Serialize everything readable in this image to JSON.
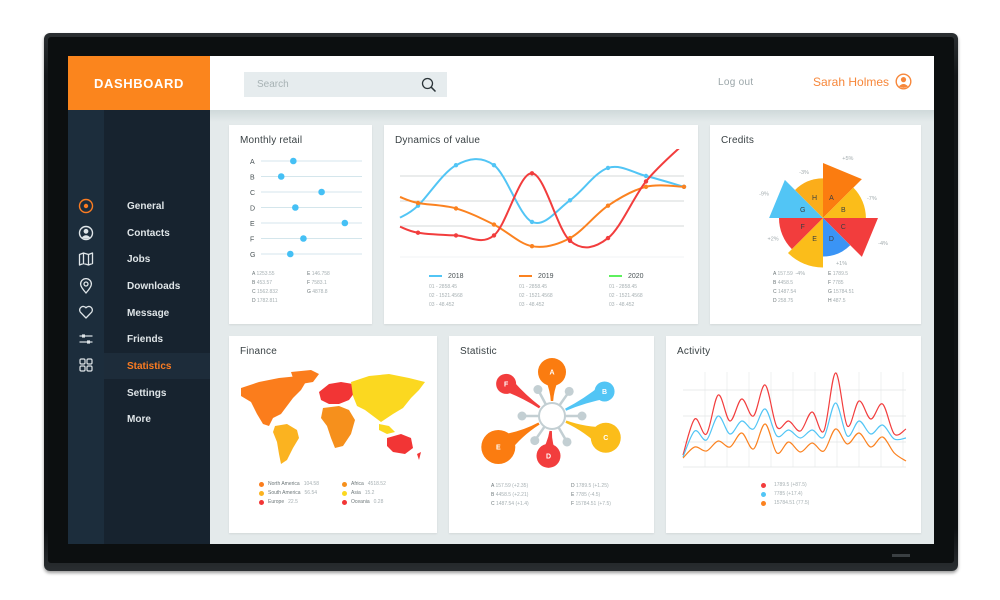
{
  "header": {
    "app_title": "DASHBOARD",
    "search_placeholder": "Search",
    "logout_label": "Log out",
    "user_name": "Sarah Holmes",
    "accent_color": "#fb851d"
  },
  "sidebar": {
    "icons": [
      "target-icon",
      "user-circle-icon",
      "map-icon",
      "location-pin-icon",
      "heart-icon",
      "sliders-icon",
      "grid-icon"
    ],
    "items": [
      {
        "label": "General"
      },
      {
        "label": "Contacts"
      },
      {
        "label": "Jobs"
      },
      {
        "label": "Downloads"
      },
      {
        "label": "Message"
      },
      {
        "label": "Friends"
      },
      {
        "label": "Statistics",
        "active": true
      },
      {
        "label": "Settings"
      },
      {
        "label": "More"
      }
    ]
  },
  "cards": {
    "monthly_retail": {
      "title": "Monthly retail",
      "rows": [
        {
          "label": "A",
          "value": 0.32
        },
        {
          "label": "B",
          "value": 0.2
        },
        {
          "label": "C",
          "value": 0.6
        },
        {
          "label": "D",
          "value": 0.34
        },
        {
          "label": "E",
          "value": 0.83
        },
        {
          "label": "F",
          "value": 0.42
        },
        {
          "label": "G",
          "value": 0.29
        }
      ],
      "stats": [
        {
          "k": "A",
          "v": "1253.55"
        },
        {
          "k": "E",
          "v": "146.758"
        },
        {
          "k": "B",
          "v": "453.57"
        },
        {
          "k": "F",
          "v": "7583.1"
        },
        {
          "k": "C",
          "v": "1562.832"
        },
        {
          "k": "G",
          "v": "4878.8"
        },
        {
          "k": "D",
          "v": "1782.811"
        }
      ]
    },
    "dynamics": {
      "title": "Dynamics of value",
      "legend": [
        {
          "label": "2018",
          "color": "#52c5f5",
          "lines": [
            "01 - 2858.45",
            "02 - 1521.4568",
            "03 - 48.452"
          ]
        },
        {
          "label": "2019",
          "color": "#fb8220",
          "lines": [
            "01 - 2858.45",
            "02 - 1521.4568",
            "03 - 48.452"
          ]
        },
        {
          "label": "2020",
          "color": "#5ef05e",
          "lines": [
            "01 - 2858.45",
            "02 - 1521.4568",
            "03 - 48.452"
          ]
        }
      ]
    },
    "credits": {
      "title": "Credits",
      "stats": [
        {
          "k": "A",
          "v": "157.59"
        },
        {
          "k": "E",
          "v": "1789.5"
        },
        {
          "k": "B",
          "v": "4458.5"
        },
        {
          "k": "F",
          "v": "7785"
        },
        {
          "k": "C",
          "v": "1487.54"
        },
        {
          "k": "G",
          "v": "15784.51"
        },
        {
          "k": "D",
          "v": "258.75"
        },
        {
          "k": "H",
          "v": "487.5"
        }
      ]
    },
    "finance": {
      "title": "Finance",
      "legend": [
        {
          "label": "North America",
          "value": "104.58",
          "color": "#fb7d1c"
        },
        {
          "label": "Africa",
          "value": "4518.52",
          "color": "#f6901c"
        },
        {
          "label": "South America",
          "value": "56.54",
          "color": "#fbb320"
        },
        {
          "label": "Asia",
          "value": "15.2",
          "color": "#fbd820"
        },
        {
          "label": "Europe",
          "value": "22.5",
          "color": "#f23535"
        },
        {
          "label": "Oceania",
          "value": "0.28",
          "color": "#f23535"
        }
      ]
    },
    "statistic": {
      "title": "Statistic",
      "stats": [
        {
          "k": "A",
          "v": "157.59 (+2.35)"
        },
        {
          "k": "D",
          "v": "1789.5 (+1.25)"
        },
        {
          "k": "B",
          "v": "4458.5 (+2.21)"
        },
        {
          "k": "E",
          "v": "7785 (-4.5)"
        },
        {
          "k": "C",
          "v": "1487.54 (+1.4)"
        },
        {
          "k": "F",
          "v": "15784.51 (+7.5)"
        }
      ]
    },
    "activity": {
      "title": "Activity",
      "legend": [
        {
          "value": "1789.5 (+87.5)",
          "color": "#f23d3d"
        },
        {
          "value": "7785 (+17.4)",
          "color": "#52c5f5"
        },
        {
          "value": "15784.51 (77.5)",
          "color": "#fb8220"
        }
      ]
    }
  },
  "chart_data": [
    {
      "type": "scatter",
      "title": "Monthly retail",
      "categories": [
        "A",
        "B",
        "C",
        "D",
        "E",
        "F",
        "G"
      ],
      "values": [
        0.32,
        0.2,
        0.6,
        0.34,
        0.83,
        0.42,
        0.29
      ],
      "xlim": [
        0,
        1
      ],
      "grid": true
    },
    {
      "type": "line",
      "title": "Dynamics of value",
      "x": [
        0,
        1,
        2,
        3,
        4,
        5,
        6,
        7
      ],
      "ylim": [
        0,
        4
      ],
      "series": [
        {
          "name": "2018",
          "color": "#52c5f5",
          "values": [
            1.9,
            3.4,
            3.4,
            1.3,
            2.1,
            3.3,
            3.0,
            2.6
          ]
        },
        {
          "name": "2019",
          "color": "#fb8220",
          "values": [
            2.0,
            1.8,
            1.2,
            0.4,
            0.7,
            1.9,
            2.6,
            2.6
          ]
        },
        {
          "name": "2018",
          "color": "#f23d3d",
          "values": [
            0.9,
            0.8,
            0.8,
            3.1,
            0.6,
            0.7,
            2.8,
            4.2
          ]
        }
      ],
      "legend": [
        "2018",
        "2019",
        "2020"
      ],
      "grid": true
    },
    {
      "type": "pie",
      "title": "Credits",
      "categories": [
        "A",
        "B",
        "C",
        "D",
        "E",
        "F",
        "G",
        "H"
      ],
      "values": [
        1.0,
        0.78,
        1.0,
        0.7,
        0.9,
        0.8,
        0.98,
        0.72
      ],
      "labels": [
        "+5%",
        "-7%",
        "-4%",
        "+1%",
        "-4%",
        "+2%",
        "-9%",
        "-3%"
      ],
      "colors": [
        "#fb7c10",
        "#fbbd1a",
        "#f23d3d",
        "#3a94f5",
        "#fbbd1a",
        "#f23d3d",
        "#52c5f5",
        "#fbad1a"
      ]
    },
    {
      "type": "line",
      "title": "Activity",
      "x": [
        0,
        1,
        2,
        3,
        4,
        5,
        6,
        7,
        8,
        9,
        10,
        11,
        12,
        13,
        14,
        15,
        16,
        17,
        18,
        19
      ],
      "ylim": [
        0,
        10
      ],
      "series": [
        {
          "name": "1789.5 (+87.5)",
          "color": "#f23d3d",
          "values": [
            1.2,
            4.8,
            3.3,
            7.2,
            4.6,
            6.8,
            5.1,
            8.2,
            4.0,
            4.6,
            3.6,
            5.5,
            3.6,
            9.4,
            4.1,
            6.6,
            4.8,
            6.3,
            3.3,
            3.8
          ]
        },
        {
          "name": "7785 (+17.4)",
          "color": "#52c5f5",
          "values": [
            1.0,
            3.6,
            2.7,
            5.1,
            3.3,
            4.6,
            3.8,
            5.8,
            3.1,
            3.7,
            2.9,
            3.7,
            3.0,
            6.4,
            3.1,
            4.6,
            3.3,
            4.2,
            2.8,
            2.9
          ]
        },
        {
          "name": "15784.51 (77.5)",
          "color": "#fb8220",
          "values": [
            0.9,
            2.0,
            1.6,
            2.6,
            2.0,
            3.4,
            1.8,
            4.3,
            1.4,
            2.5,
            1.5,
            2.4,
            1.6,
            3.8,
            2.3,
            3.4,
            2.0,
            3.0,
            1.4,
            0.6
          ]
        }
      ],
      "grid": true
    }
  ]
}
